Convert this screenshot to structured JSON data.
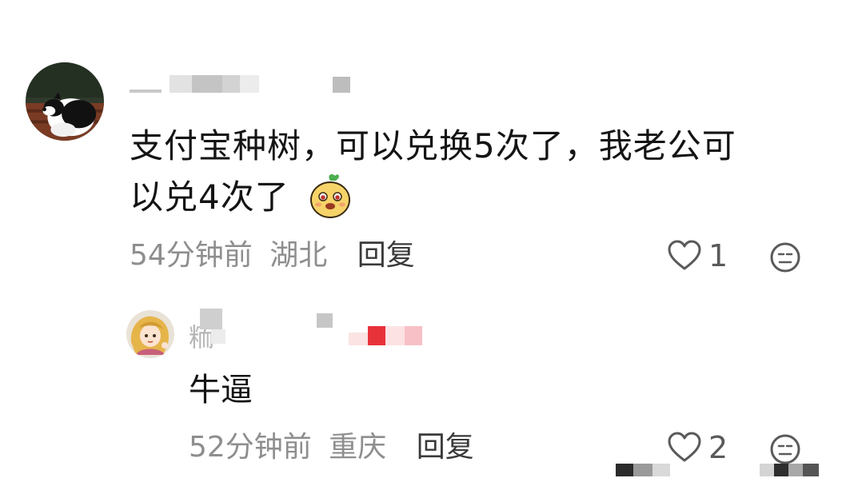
{
  "comment": {
    "text_line1": "支付宝种树，可以兑换5次了，我老公可",
    "text_line2": "以兑4次了",
    "emoji_icon": "sprout-bun-emoji",
    "time": "54分钟前",
    "location": "湖北",
    "reply_label": "回复",
    "like_count": "1"
  },
  "reply": {
    "username_visible": "粫",
    "text": "牛逼",
    "time": "52分钟前",
    "location": "重庆",
    "reply_label": "回复",
    "like_count": "2"
  },
  "colors": {
    "text": "#141414",
    "meta": "#8e8e8e",
    "reply_button": "#3a3a3a",
    "icon": "#5a5a5a",
    "mosaic_red": "#e8323a"
  },
  "icons": {
    "like": "heart-outline-icon",
    "reaction": "neutral-face-icon"
  }
}
